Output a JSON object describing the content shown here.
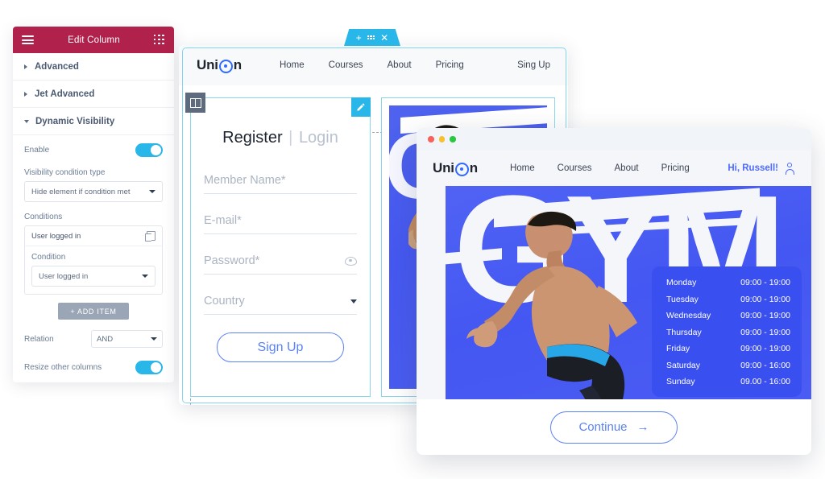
{
  "editor_panel": {
    "header": {
      "title": "Edit Column",
      "menu_icon": "hamburger-icon",
      "grid_icon": "grid-dots-icon"
    },
    "sections": [
      {
        "label": "Advanced",
        "expanded": false
      },
      {
        "label": "Jet Advanced",
        "expanded": false
      },
      {
        "label": "Dynamic Visibility",
        "expanded": true
      }
    ],
    "enable": {
      "label": "Enable",
      "value": "on"
    },
    "visibility_condition_type": {
      "label": "Visibility condition type",
      "value": "Hide element if condition met"
    },
    "conditions": {
      "label": "Conditions",
      "item_title": "User logged in",
      "duplicate_icon": "duplicate-icon",
      "condition_label": "Condition",
      "condition_value": "User logged in"
    },
    "add_item_button": "+  ADD ITEM",
    "relation": {
      "label": "Relation",
      "value": "AND"
    },
    "resize_other_columns": {
      "label": "Resize other columns",
      "value": "on"
    }
  },
  "middle_window": {
    "tab_handle": {
      "add_icon": "plus-icon",
      "drag_icon": "grid-dots-icon",
      "close_icon": "close-icon"
    },
    "site_nav": {
      "brand_left": "Uni",
      "brand_right": "n",
      "links": [
        "Home",
        "Courses",
        "About",
        "Pricing"
      ],
      "right_link": "Sing Up"
    },
    "column_handle_icon": "columns-icon",
    "edit_pencil_icon": "pencil-icon",
    "register_form": {
      "title_active": "Register",
      "title_divider": "|",
      "title_inactive": "Login",
      "fields": [
        {
          "placeholder": "Member Name*",
          "icon": ""
        },
        {
          "placeholder": "E-mail*",
          "icon": ""
        },
        {
          "placeholder": "Password*",
          "icon": "eye-icon"
        },
        {
          "placeholder": "Country",
          "icon": "chevron-down-icon"
        }
      ],
      "submit_label": "Sign Up"
    },
    "hero_text": "GYM"
  },
  "front_window": {
    "titlebar_dots": [
      "#f9615b",
      "#f9c02e",
      "#28c940"
    ],
    "site_nav": {
      "brand_left": "Uni",
      "brand_right": "n",
      "links": [
        "Home",
        "Courses",
        "About",
        "Pricing"
      ],
      "user_greeting": "Hi, Russell!",
      "user_icon": "user-icon"
    },
    "hero_text": "GYM",
    "schedule": [
      {
        "day": "Monday",
        "hours": "09:00 - 19:00"
      },
      {
        "day": "Tuesday",
        "hours": "09:00 - 19:00"
      },
      {
        "day": "Wednesday",
        "hours": "09:00 - 19:00"
      },
      {
        "day": "Thursday",
        "hours": "09:00 - 19:00"
      },
      {
        "day": "Friday",
        "hours": "09:00 - 19:00"
      },
      {
        "day": "Saturday",
        "hours": "09:00 - 16:00"
      },
      {
        "day": "Sunday",
        "hours": "09.00 - 16:00"
      }
    ],
    "continue_button": {
      "label": "Continue",
      "icon": "arrow-right-icon",
      "arrow": "→"
    }
  },
  "colors": {
    "panel_header": "#b0224b",
    "accent_cyan": "#29b6e8",
    "brand_blue": "#4f6bff",
    "hero_blue": "#4457f2",
    "schedule_card": "#3a4ff0"
  }
}
